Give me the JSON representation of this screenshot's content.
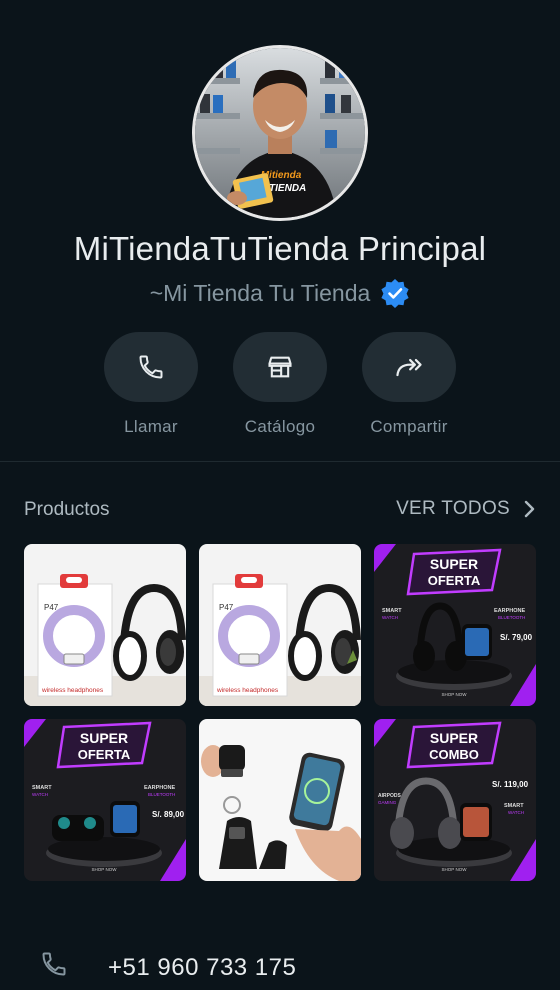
{
  "profile": {
    "name": "MiTiendaTuTienda Principal",
    "subtitle": "~Mi Tienda Tu Tienda",
    "shirt_line1": "Mitienda",
    "shirt_line2": "TUTIENDA"
  },
  "actions": [
    {
      "label": "Llamar",
      "icon": "phone-icon"
    },
    {
      "label": "Catálogo",
      "icon": "storefront-icon"
    },
    {
      "label": "Compartir",
      "icon": "share-icon"
    }
  ],
  "products": {
    "title": "Productos",
    "see_all": "VER TODOS",
    "items": [
      {
        "kind": "headphones",
        "box_model": "P47",
        "box_text": "wireless headphones"
      },
      {
        "kind": "headphones",
        "box_model": "P47",
        "box_text": "wireless headphones"
      },
      {
        "kind": "promo",
        "headline1": "SUPER",
        "headline2": "OFERTA",
        "left_tag": "SMART",
        "left_tag2": "WATCH",
        "right_tag": "EARPHONE",
        "right_tag2": "BLUETOOTH",
        "price": "S/. 79,00",
        "cta": "SHOP NOW"
      },
      {
        "kind": "promo",
        "headline1": "SUPER",
        "headline2": "OFERTA",
        "left_tag": "SMART",
        "left_tag2": "WATCH",
        "right_tag": "EARPHONE",
        "right_tag2": "BLUETOOTH",
        "price": "S/. 89,00",
        "cta": "SHOP NOW"
      },
      {
        "kind": "powerbank"
      },
      {
        "kind": "promo",
        "headline1": "SUPER",
        "headline2": "COMBO",
        "left_tag": "AIRPODS",
        "left_tag2": "GAMING",
        "right_tag": "SMART",
        "right_tag2": "WATCH",
        "price": "S/. 119,00",
        "cta": "SHOP NOW"
      }
    ]
  },
  "contact": {
    "phone": "+51 960 733 175"
  },
  "colors": {
    "background": "#0b141a",
    "accent_purple": "#a020f0",
    "verified_blue": "#2c8cf4"
  }
}
